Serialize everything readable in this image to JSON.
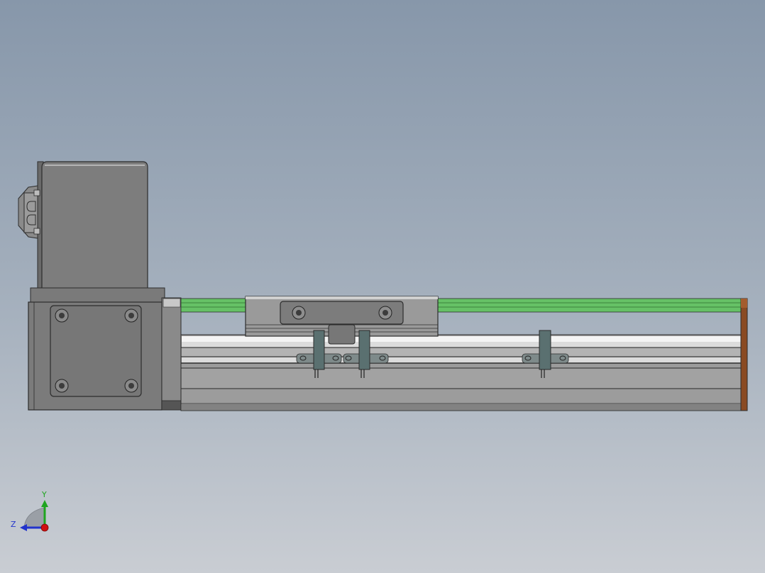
{
  "scene": {
    "kind": "cad-assembly-view",
    "view": "front",
    "background_top": "#8797aa",
    "background_bottom": "#c9cdd3"
  },
  "assembly": {
    "parts": [
      "stepper-motor",
      "motor-connector",
      "motor-mount-block",
      "coupling-housing",
      "aluminum-rail-profile",
      "green-dust-cover-strip",
      "carriage",
      "carriage-top-plate",
      "cap-screw-icon",
      "sensor-flag",
      "limit-sensor",
      "end-cap"
    ],
    "colors": {
      "motor_body": "#7c7c7c",
      "motor_edge": "#3c3c3c",
      "rail_body": "#9b9b9b",
      "rail_highlight": "#f4f4f4",
      "cover_strip": "#66c166",
      "sensor": "#5a7070",
      "end_cap": "#8a4a22"
    }
  },
  "triad": {
    "y_label": "Y",
    "z_label": "Z",
    "y_color": "#1fa51f",
    "z_color": "#2233cc",
    "origin_color": "#d01010"
  }
}
